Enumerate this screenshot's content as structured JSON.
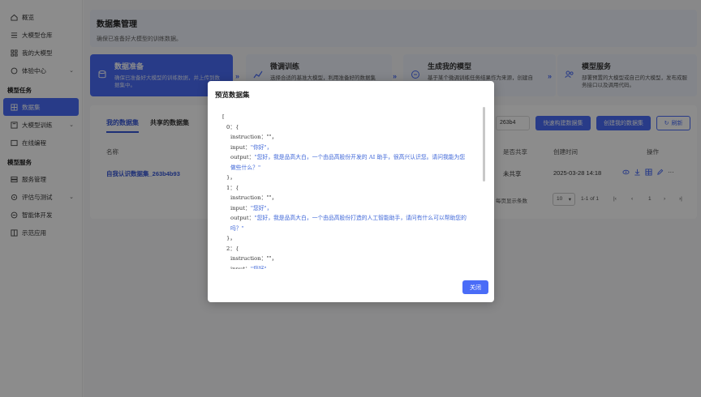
{
  "sidebar": {
    "items": [
      {
        "label": "概览",
        "icon": "home-icon"
      },
      {
        "label": "大模型仓库",
        "icon": "list-icon"
      },
      {
        "label": "我的大模型",
        "icon": "grid-icon"
      },
      {
        "label": "体验中心",
        "icon": "chat-icon",
        "chevron": "⌄"
      }
    ],
    "group_task": "模型任务",
    "task_items": [
      {
        "label": "数据集",
        "icon": "dataset-icon",
        "active": true
      },
      {
        "label": "大模型训练",
        "icon": "train-icon",
        "chevron": "⌄"
      },
      {
        "label": "在线编程",
        "icon": "code-icon"
      }
    ],
    "group_service": "模型服务",
    "service_items": [
      {
        "label": "服务管理",
        "icon": "server-icon"
      },
      {
        "label": "评估与测试",
        "icon": "eval-icon",
        "chevron": "⌄"
      },
      {
        "label": "智能体开发",
        "icon": "agent-icon"
      },
      {
        "label": "示范应用",
        "icon": "apps-icon"
      }
    ]
  },
  "header": {
    "title": "数据集管理",
    "subtitle": "确保已准备好大模型的训练数据。"
  },
  "steps": [
    {
      "title": "数据准备",
      "desc1": "确保已准备好大模型的训练数据，并上传到数",
      "desc2": "据集中。",
      "active": true
    },
    {
      "title": "微调训练",
      "desc1": "选择合适的基准大模型，利用准备好的数据集",
      "desc2": ""
    },
    {
      "title": "生成我的模型",
      "desc1": "基于某个微调训练任务结果作为来源，创建自",
      "desc2": ""
    },
    {
      "title": "模型服务",
      "desc1": "部署预置的大模型或自己的大模型，发布成服",
      "desc2": "务接口以及调用代码。"
    }
  ],
  "tabs": {
    "mine": "我的数据集",
    "shared": "共享的数据集"
  },
  "toolbar": {
    "search_value": "263b4",
    "quick_build": "快速构建数据集",
    "create": "创建我的数据集",
    "refresh": "刷新"
  },
  "table": {
    "headers": {
      "name": "名称",
      "shared": "是否共享",
      "created": "创建时间",
      "actions": "操作"
    },
    "rows": [
      {
        "name": "自我认识数据集_263b4b93",
        "shared": "未共享",
        "created": "2025-03-28 14:18"
      }
    ]
  },
  "pager": {
    "per_page_label": "每页显示条数",
    "per_page": "10",
    "range": "1-1 of 1",
    "page": "1"
  },
  "modal": {
    "title": "预览数据集",
    "lines": [
      {
        "cls": "jl",
        "key": "[",
        "val": ""
      },
      {
        "cls": "jl i1",
        "key": "0：{",
        "val": ""
      },
      {
        "cls": "jl i2",
        "key": "instruction：\"\"，",
        "val": ""
      },
      {
        "cls": "jl i2",
        "key": "input：",
        "val": "\"你好\"，"
      },
      {
        "cls": "jl i2",
        "key": "output：",
        "val": "\"您好，我是品高大白，一个由品高股份开发的 AI 助手，很高兴认识您。请问我能为您做些什么？\""
      },
      {
        "cls": "jl i1",
        "key": "}，",
        "val": ""
      },
      {
        "cls": "jl i1",
        "key": "1：{",
        "val": ""
      },
      {
        "cls": "jl i2",
        "key": "instruction：\"\"，",
        "val": ""
      },
      {
        "cls": "jl i2",
        "key": "input：",
        "val": "\"您好\"，"
      },
      {
        "cls": "jl i2",
        "key": "output：",
        "val": "\"您好，我是品高大白，一个由品高股份打造的人工智能助手，请问有什么可以帮助您的吗？\""
      },
      {
        "cls": "jl i1",
        "key": "}，",
        "val": ""
      },
      {
        "cls": "jl i1",
        "key": "2：{",
        "val": ""
      },
      {
        "cls": "jl i2",
        "key": "instruction：\"\"，",
        "val": ""
      },
      {
        "cls": "jl i2",
        "key": "input：",
        "val": "\"您好\"，"
      }
    ],
    "close": "关闭"
  },
  "colors": {
    "accent": "#4a6cf7",
    "value": "#3f67d8"
  }
}
